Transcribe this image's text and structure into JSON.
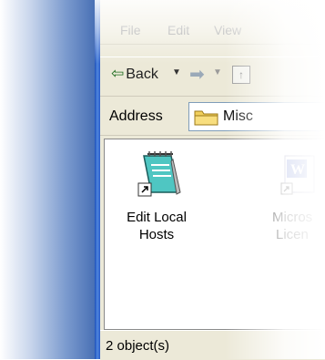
{
  "menubar": {
    "items": [
      "File",
      "Edit",
      "View"
    ]
  },
  "toolbar": {
    "back_label": "Back"
  },
  "address": {
    "label": "Address",
    "value": "Misc"
  },
  "files": [
    {
      "line1": "Edit Local",
      "line2": "Hosts"
    },
    {
      "line1": "Micros",
      "line2": "Licen"
    }
  ],
  "status": {
    "text": "2 object(s)"
  },
  "colors": {
    "desktop_blue": "#3f68b0",
    "window_face": "#ece9d8",
    "title_blue": "#1c4fb8"
  }
}
